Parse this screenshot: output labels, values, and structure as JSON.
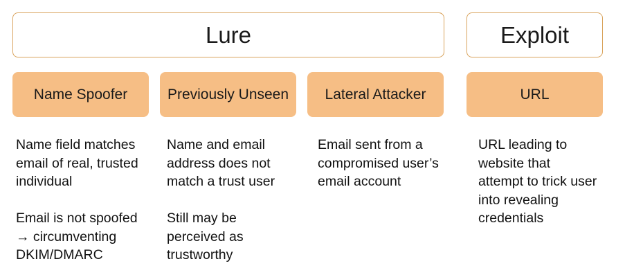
{
  "headers": {
    "lure": "Lure",
    "exploit": "Exploit"
  },
  "categories": [
    {
      "label": "Name Spoofer",
      "paragraphs": [
        [
          "Name field matches",
          "email of real, trusted",
          "individual"
        ],
        [
          "Email is not spoofed",
          "→ circumventing",
          "DKIM/DMARC"
        ]
      ]
    },
    {
      "label": "Previously Unseen",
      "paragraphs": [
        [
          "Name and email",
          "address does not",
          "match a trust user"
        ],
        [
          "Still may be",
          "perceived as",
          "trustworthy"
        ]
      ]
    },
    {
      "label": "Lateral Attacker",
      "paragraphs": [
        [
          "Email sent from a",
          "compromised user’s",
          "email account"
        ]
      ]
    },
    {
      "label": "URL",
      "paragraphs": [
        [
          "URL leading to",
          "website that",
          "attempt to trick user",
          "into revealing",
          "credentials"
        ]
      ]
    }
  ],
  "colors": {
    "border": "#d9a35c",
    "fill": "#f6be85"
  }
}
